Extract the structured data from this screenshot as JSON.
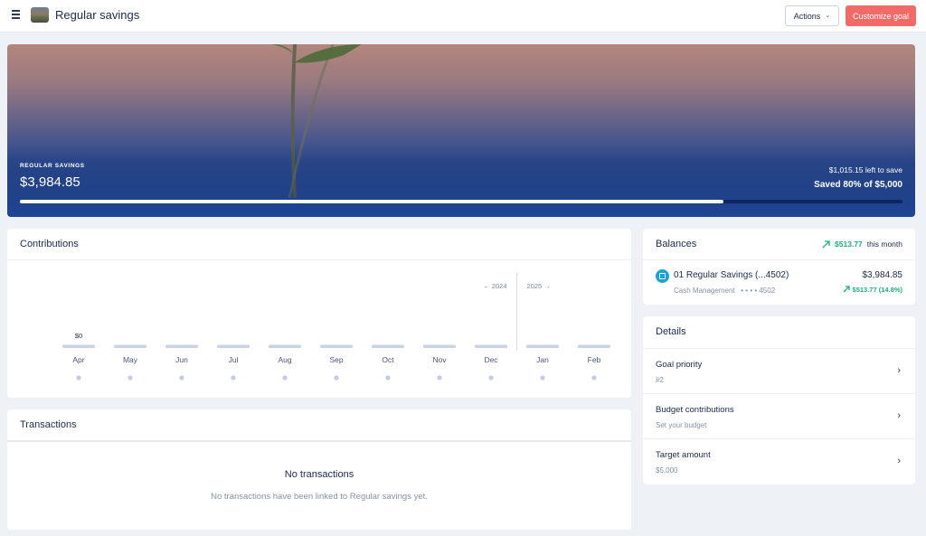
{
  "header": {
    "title": "Regular savings",
    "actions_label": "Actions",
    "customize_label": "Customize goal"
  },
  "hero": {
    "label": "REGULAR SAVINGS",
    "amount": "$3,984.85",
    "left_to_save": "$1,015.15 left to save",
    "saved_text": "Saved 80% of $5,000",
    "progress_fraction": 0.797
  },
  "contributions": {
    "title": "Contributions",
    "year_prev": "← 2024",
    "year_next": "2025 →",
    "months": [
      "Apr",
      "May",
      "Jun",
      "Jul",
      "Aug",
      "Sep",
      "Oct",
      "Nov",
      "Dec",
      "Jan",
      "Feb"
    ],
    "amount_label": "$0"
  },
  "chart_data": {
    "type": "bar",
    "categories": [
      "Apr",
      "May",
      "Jun",
      "Jul",
      "Aug",
      "Sep",
      "Oct",
      "Nov",
      "Dec",
      "Jan",
      "Feb"
    ],
    "values": [
      0,
      0,
      0,
      0,
      0,
      0,
      0,
      0,
      0,
      0,
      0
    ],
    "title": "Contributions",
    "data_labels": [
      "$0"
    ],
    "annotations": [
      "← 2024",
      "2025 →"
    ]
  },
  "transactions": {
    "title": "Transactions",
    "empty_title": "No transactions",
    "empty_sub": "No transactions have been linked to Regular savings yet."
  },
  "balances": {
    "title": "Balances",
    "month_change": "$513.77",
    "month_label": "this month",
    "account": {
      "name": "01 Regular Savings (...4502)",
      "type": "Cash Management",
      "mask": "• • • • 4502",
      "balance": "$3,984.85",
      "change": "$513.77 (14.8%)"
    }
  },
  "details": {
    "title": "Details",
    "rows": [
      {
        "label": "Goal priority",
        "value": "#2"
      },
      {
        "label": "Budget contributions",
        "value": "Set your budget"
      },
      {
        "label": "Target amount",
        "value": "$5,000"
      }
    ]
  },
  "colors": {
    "accent": "#f06b67",
    "positive": "#1fb07f",
    "hero_blue": "#1f4596",
    "bar": "#c9d3e3"
  }
}
